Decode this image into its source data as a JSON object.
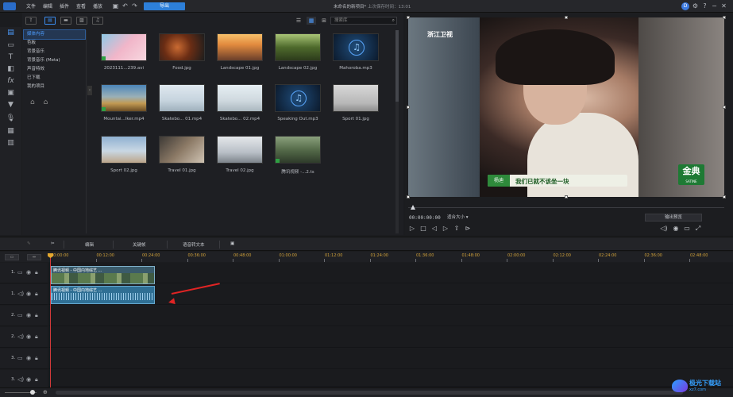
{
  "titlebar": {
    "menus": [
      "文件",
      "编辑",
      "插件",
      "查看",
      "播放"
    ],
    "export_label": "导出",
    "doc_title": "未命名的新项目*",
    "saved_text": "上次保存时间：13:01",
    "user_initial": "D",
    "help": "?"
  },
  "library": {
    "search_placeholder": "搜索库",
    "categories": [
      "媒体内容",
      "色板",
      "背景音乐",
      "背景音乐 (Meta)",
      "声音特效",
      "已下载",
      "我的项目"
    ],
    "items": [
      {
        "label": "2023111...239.avi",
        "kind": "video",
        "checked": true
      },
      {
        "label": "Food.jpg",
        "kind": "image",
        "checked": false
      },
      {
        "label": "Landscape 01.jpg",
        "kind": "image",
        "checked": false
      },
      {
        "label": "Landscape 02.jpg",
        "kind": "image",
        "checked": false
      },
      {
        "label": "Mahoroba.mp3",
        "kind": "audio",
        "checked": false
      },
      {
        "label": "Mountai...lker.mp4",
        "kind": "video",
        "checked": true
      },
      {
        "label": "Skatebo... 01.mp4",
        "kind": "video",
        "checked": false
      },
      {
        "label": "Skatebo... 02.mp4",
        "kind": "video",
        "checked": false
      },
      {
        "label": "Speaking Out.mp3",
        "kind": "audio",
        "checked": false
      },
      {
        "label": "Sport 01.jpg",
        "kind": "image",
        "checked": false
      },
      {
        "label": "Sport 02.jpg",
        "kind": "image",
        "checked": false
      },
      {
        "label": "Travel 01.jpg",
        "kind": "image",
        "checked": false
      },
      {
        "label": "Travel 02.jpg",
        "kind": "image",
        "checked": false
      },
      {
        "label": "腾讯视频 -...2.ts",
        "kind": "video",
        "checked": true
      }
    ]
  },
  "preview": {
    "channel_logo": "浙江卫视",
    "caption_name": "杨迪",
    "caption_text": "我们已就不该坐一块",
    "sponsor": "金典",
    "sponsor_sub": "SATINE",
    "timecode": "00:00:00:00",
    "fit_label": "适合大小",
    "output_preview_label": "输出预览"
  },
  "timeline_toolbar": {
    "edit": "编辑",
    "keyframe": "关键帧",
    "speech_to_text": "语音转文本"
  },
  "ruler": {
    "labels": [
      "00:00:00",
      "00:12:00",
      "00:24:00",
      "00:36:00",
      "00:48:00",
      "01:00:00",
      "01:12:00",
      "01:24:00",
      "01:36:00",
      "01:48:00",
      "02:00:00",
      "02:12:00",
      "02:24:00",
      "02:36:00",
      "02:48:00"
    ]
  },
  "tracks": [
    {
      "label": "1.",
      "type": "video"
    },
    {
      "label": "1.",
      "type": "audio"
    },
    {
      "label": "2.",
      "type": "video"
    },
    {
      "label": "2.",
      "type": "audio"
    },
    {
      "label": "3.",
      "type": "video"
    },
    {
      "label": "3.",
      "type": "audio"
    }
  ],
  "clip": {
    "video_title": "腾讯视频 - 中国内地综艺 ...",
    "audio_title": "腾讯视频 - 中国内地综艺 ..."
  },
  "watermark": {
    "text": "极光下载站",
    "sub": "xz7.com"
  }
}
